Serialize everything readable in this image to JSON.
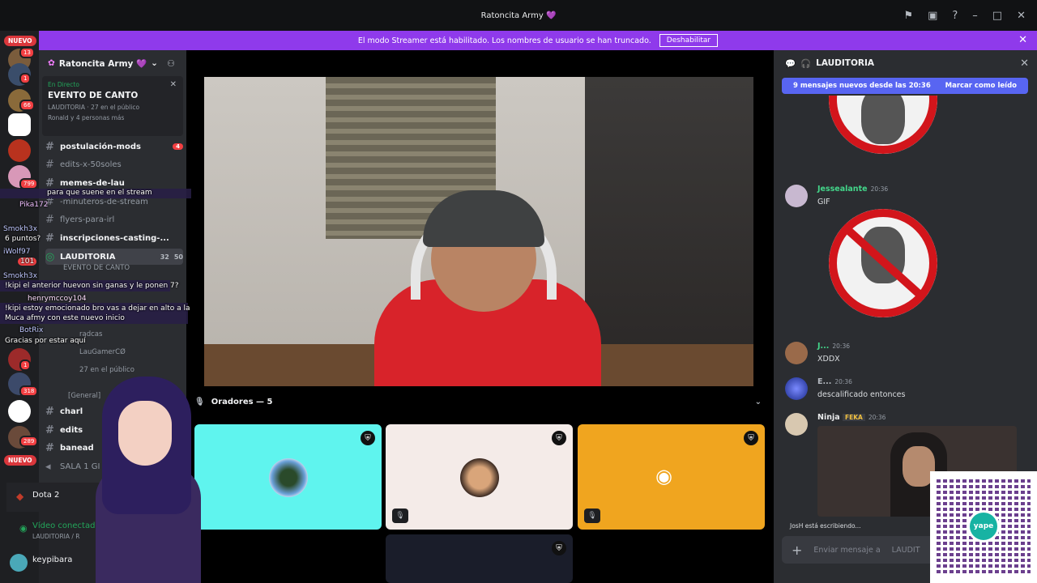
{
  "window": {
    "title": "Ratoncita Army 💜"
  },
  "banner": {
    "text": "El modo Streamer está habilitado. Los nombres de usuario se han truncado.",
    "button": "Deshabilitar"
  },
  "guilds": {
    "new_pill": "NUEVO",
    "badges": [
      "13",
      "1",
      "66",
      "799",
      "1",
      "318",
      "289"
    ],
    "new_pill2": "NUEVO"
  },
  "server": {
    "name": "Ratoncita Army 💜"
  },
  "event": {
    "live": "En Directo",
    "title": "EVENTO DE CANTO",
    "meta": "LAUDITORIA · 27 en el público",
    "people": "Ronald y 4 personas más"
  },
  "channels": [
    {
      "name": "postulación-mods",
      "badge": "4"
    },
    {
      "name": "edits-x-50soles"
    },
    {
      "name": "memes-de-lau"
    },
    {
      "name": "-minuteros-de-stream"
    },
    {
      "name": "flyers-para-irl"
    },
    {
      "name": "inscripciones-casting-..."
    }
  ],
  "voice_channel": {
    "name": "LAUDITORIA",
    "count1": "32",
    "count2": "50",
    "sub": "EVENTO DE CANTO"
  },
  "voice_users": [
    "radcas",
    "LauGamerCØ"
  ],
  "audience": "27 en el público",
  "category": "[General]",
  "more_channels": [
    "charl",
    "edits",
    "banead",
    "SALA 1 GI"
  ],
  "user_panel": {
    "game": "Dota 2",
    "video": "Vídeo conectado",
    "video_sub": "LAUDITORIA / R",
    "username": "keypibara"
  },
  "stage": {
    "speakers_label": "Oradores — 5"
  },
  "chat": {
    "title": "LAUDITORIA",
    "new_messages": "9 mensajes nuevos desde las 20:36",
    "mark_read": "Marcar como leído",
    "messages": [
      {
        "name": "Jessealante",
        "time": "20:36",
        "text": "GIF"
      },
      {
        "name": "J...",
        "time": "20:36",
        "text": "XDDX"
      },
      {
        "name": "E...",
        "time": "20:36",
        "text": "descalificado entonces"
      },
      {
        "name": "Ninja",
        "tag": "FEKA",
        "time": "20:36",
        "text": ""
      }
    ],
    "typing": "JosH está escribiendo...",
    "input_placeholder": "Enviar mensaje a",
    "input_target": "LAUDIT"
  },
  "overlay_chat": [
    {
      "text": "para que suene en el stream"
    },
    {
      "name": "Pika172"
    },
    {
      "name": "Smokh3x",
      "text": "6 puntos?"
    },
    {
      "name": "iWolf97",
      "badge": "101"
    },
    {
      "name": "Smokh3x",
      "text": "!kipi el anterior huevon sin ganas y le ponen 7?"
    },
    {
      "name": "henrymccoy104"
    },
    {
      "text": "!kipi estoy emocionado bro vas a dejar en alto a la"
    },
    {
      "text": "Muca afmy con este nuevo inicio"
    },
    {
      "name": "BotRix"
    },
    {
      "text": "Gracias por estar aquí"
    }
  ],
  "qr": {
    "logo": "yape"
  },
  "colors": {
    "accent": "#5865f2",
    "streamer_banner": "#8f3aeb",
    "live": "#23a55a",
    "danger": "#f23f42"
  }
}
